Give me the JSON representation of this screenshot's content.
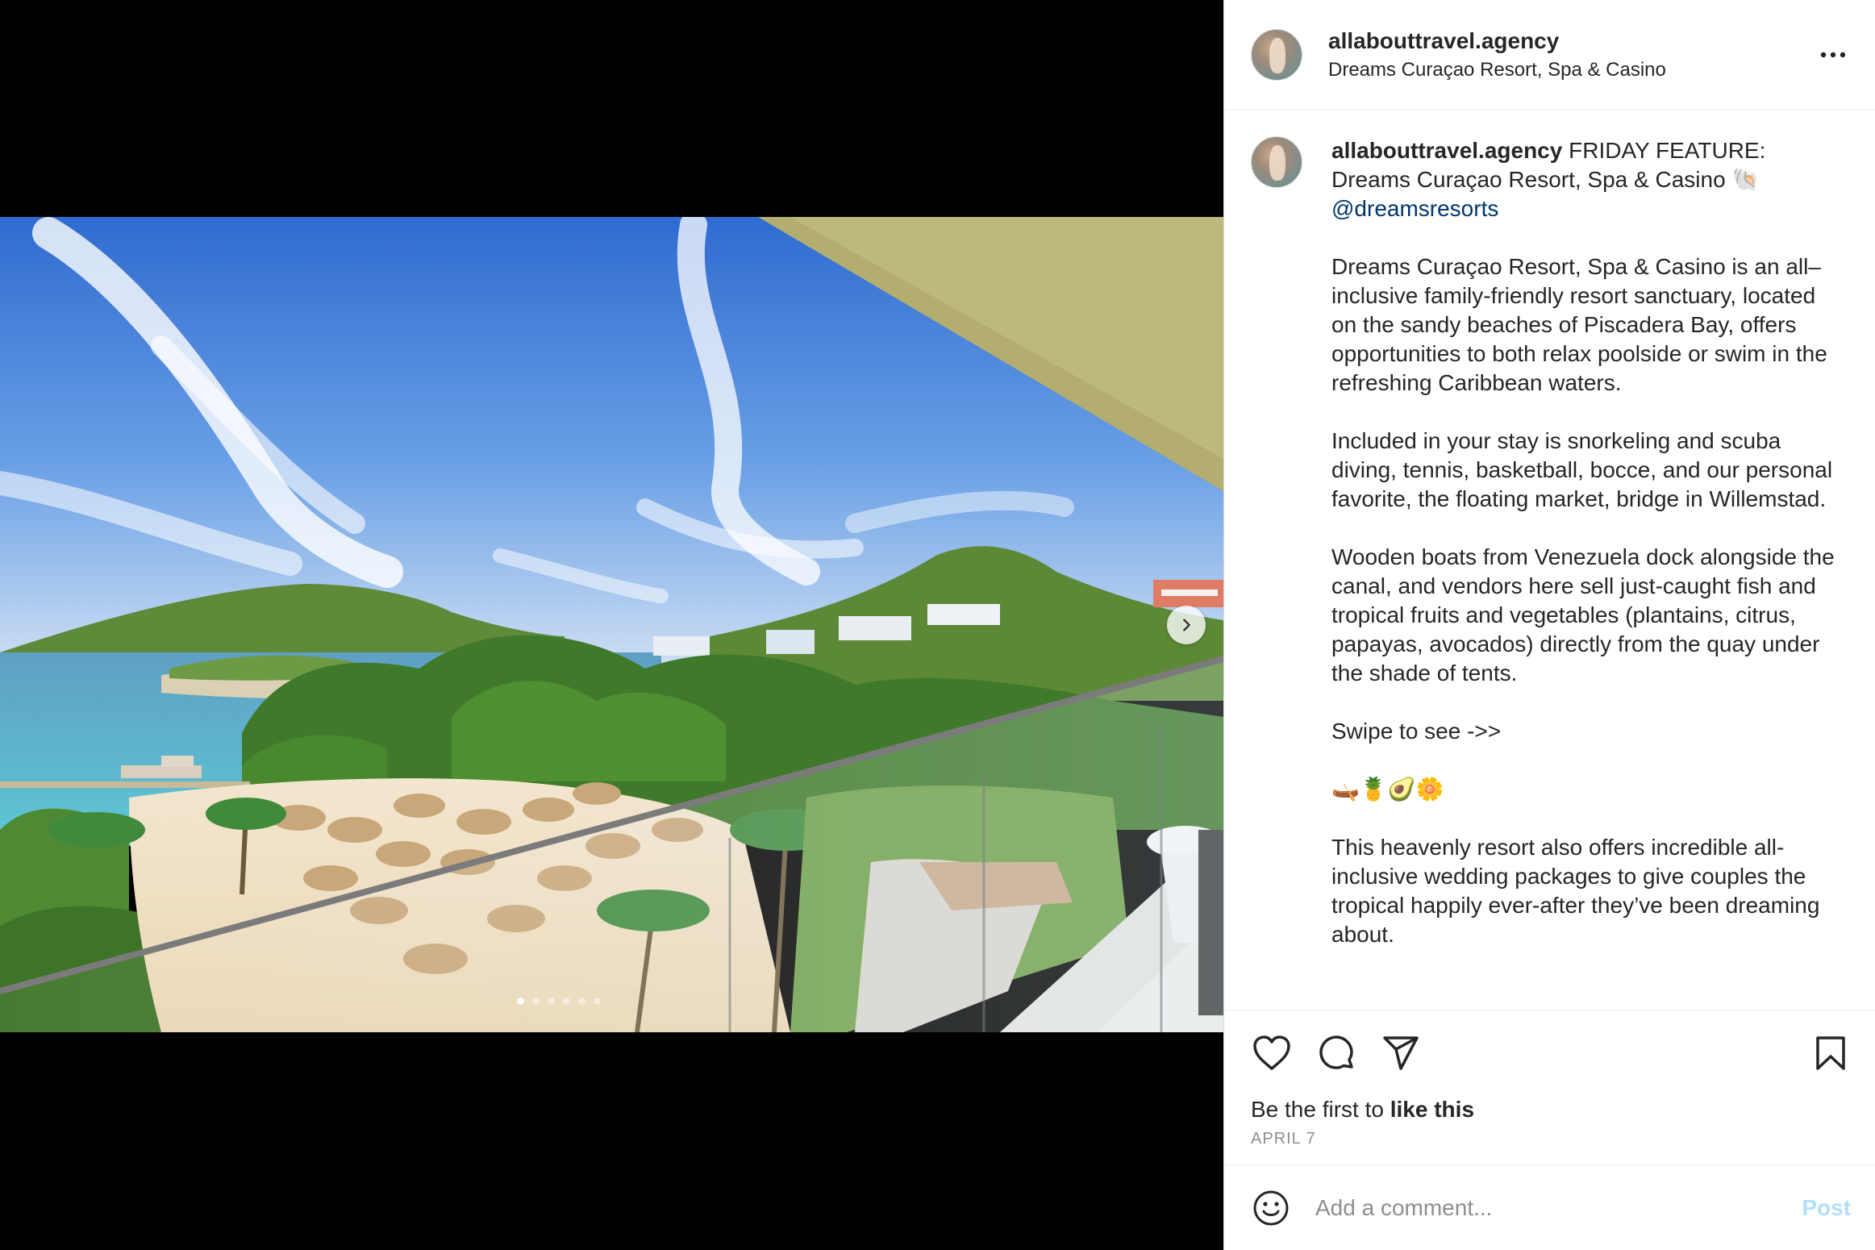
{
  "post": {
    "username": "allabouttravel.agency",
    "location": "Dreams Curaçao Resort, Spa & Casino",
    "media": {
      "slide_count": 6,
      "active_slide": 1
    }
  },
  "caption": {
    "username": "allabouttravel.agency",
    "intro": " FRIDAY FEATURE: Dreams Curaçao Resort, Spa & Casino 🐚 ",
    "mention": "@dreamsresorts",
    "paragraphs": [
      "Dreams Curaçao Resort, Spa & Casino is an all–inclusive family-friendly resort sanctuary, located on the sandy beaches of Piscadera Bay, offers opportunities to both relax poolside or swim in the refreshing Caribbean waters.",
      "Included in your stay is snorkeling and scuba diving, tennis, basketball, bocce, and our personal favorite, the floating market, bridge in Willemstad.",
      "Wooden boats from Venezuela dock alongside the canal, and vendors here sell just-caught fish and tropical fruits and vegetables (plantains, citrus, papayas, avocados) directly from the quay under the shade of tents.",
      "Swipe to see ->>",
      "🛶🍍🥑🌼",
      "This heavenly resort also offers incredible all-inclusive wedding packages to give couples the tropical happily ever-after they’ve been dreaming about."
    ]
  },
  "engagement": {
    "likes_prefix": "Be the first to ",
    "likes_action": "like this",
    "date": "APRIL 7"
  },
  "comment": {
    "placeholder": "Add a comment...",
    "post_label": "Post"
  },
  "icons": {
    "more": "more-horizontal-icon",
    "like": "heart-icon",
    "comment": "comment-bubble-icon",
    "share": "paper-plane-icon",
    "save": "bookmark-icon",
    "emoji": "smiley-icon",
    "next": "chevron-right-icon"
  },
  "colors": {
    "mention": "#00376b",
    "post_disabled": "#b2dffc",
    "muted": "#8e8e8e",
    "text": "#262626"
  }
}
